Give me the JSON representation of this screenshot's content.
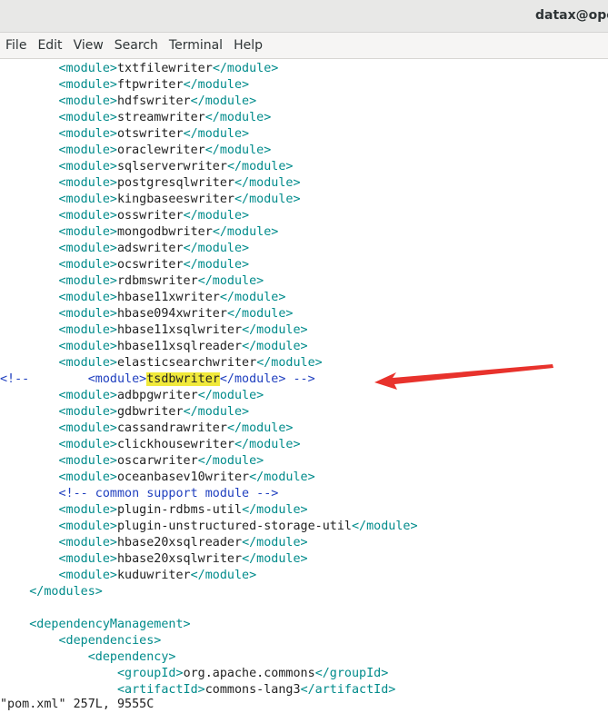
{
  "window": {
    "title": "datax@oper"
  },
  "menu": [
    "File",
    "Edit",
    "View",
    "Search",
    "Terminal",
    "Help"
  ],
  "colors": {
    "tag": "#008b8b",
    "text": "#222222",
    "comment": "#1f3fbf",
    "highlight": "#f0e93a",
    "arrow": "#e8322c"
  },
  "editor": {
    "lines": [
      {
        "indent": "        ",
        "open": "<module>",
        "text": "txtfilewriter",
        "close": "</module>"
      },
      {
        "indent": "        ",
        "open": "<module>",
        "text": "ftpwriter",
        "close": "</module>"
      },
      {
        "indent": "        ",
        "open": "<module>",
        "text": "hdfswriter",
        "close": "</module>"
      },
      {
        "indent": "        ",
        "open": "<module>",
        "text": "streamwriter",
        "close": "</module>"
      },
      {
        "indent": "        ",
        "open": "<module>",
        "text": "otswriter",
        "close": "</module>"
      },
      {
        "indent": "        ",
        "open": "<module>",
        "text": "oraclewriter",
        "close": "</module>"
      },
      {
        "indent": "        ",
        "open": "<module>",
        "text": "sqlserverwriter",
        "close": "</module>"
      },
      {
        "indent": "        ",
        "open": "<module>",
        "text": "postgresqlwriter",
        "close": "</module>"
      },
      {
        "indent": "        ",
        "open": "<module>",
        "text": "kingbaseeswriter",
        "close": "</module>"
      },
      {
        "indent": "        ",
        "open": "<module>",
        "text": "osswriter",
        "close": "</module>"
      },
      {
        "indent": "        ",
        "open": "<module>",
        "text": "mongodbwriter",
        "close": "</module>"
      },
      {
        "indent": "        ",
        "open": "<module>",
        "text": "adswriter",
        "close": "</module>"
      },
      {
        "indent": "        ",
        "open": "<module>",
        "text": "ocswriter",
        "close": "</module>"
      },
      {
        "indent": "        ",
        "open": "<module>",
        "text": "rdbmswriter",
        "close": "</module>"
      },
      {
        "indent": "        ",
        "open": "<module>",
        "text": "hbase11xwriter",
        "close": "</module>"
      },
      {
        "indent": "        ",
        "open": "<module>",
        "text": "hbase094xwriter",
        "close": "</module>"
      },
      {
        "indent": "        ",
        "open": "<module>",
        "text": "hbase11xsqlwriter",
        "close": "</module>"
      },
      {
        "indent": "        ",
        "open": "<module>",
        "text": "hbase11xsqlreader",
        "close": "</module>"
      },
      {
        "indent": "        ",
        "open": "<module>",
        "text": "elasticsearchwriter",
        "close": "</module>"
      },
      {
        "comment_open": "<!--",
        "indent": "        ",
        "open": "<module>",
        "text": "tsdbwriter",
        "close": "</module>",
        "comment_close": " -->",
        "highlight": true
      },
      {
        "indent": "        ",
        "open": "<module>",
        "text": "adbpgwriter",
        "close": "</module>"
      },
      {
        "indent": "        ",
        "open": "<module>",
        "text": "gdbwriter",
        "close": "</module>"
      },
      {
        "indent": "        ",
        "open": "<module>",
        "text": "cassandrawriter",
        "close": "</module>"
      },
      {
        "indent": "        ",
        "open": "<module>",
        "text": "clickhousewriter",
        "close": "</module>"
      },
      {
        "indent": "        ",
        "open": "<module>",
        "text": "oscarwriter",
        "close": "</module>"
      },
      {
        "indent": "        ",
        "open": "<module>",
        "text": "oceanbasev10writer",
        "close": "</module>"
      },
      {
        "indent": "        ",
        "comment": "<!-- common support module -->"
      },
      {
        "indent": "        ",
        "open": "<module>",
        "text": "plugin-rdbms-util",
        "close": "</module>"
      },
      {
        "indent": "        ",
        "open": "<module>",
        "text": "plugin-unstructured-storage-util",
        "close": "</module>"
      },
      {
        "indent": "        ",
        "open": "<module>",
        "text": "hbase20xsqlreader",
        "close": "</module>"
      },
      {
        "indent": "        ",
        "open": "<module>",
        "text": "hbase20xsqlwriter",
        "close": "</module>"
      },
      {
        "indent": "        ",
        "open": "<module>",
        "text": "kuduwriter",
        "close": "</module>"
      },
      {
        "indent": "    ",
        "open": "</modules>"
      },
      {
        "indent": ""
      },
      {
        "indent": "    ",
        "open": "<dependencyManagement>"
      },
      {
        "indent": "        ",
        "open": "<dependencies>"
      },
      {
        "indent": "            ",
        "open": "<dependency>"
      },
      {
        "indent": "                ",
        "open": "<groupId>",
        "text": "org.apache.commons",
        "close": "</groupId>"
      },
      {
        "indent": "                ",
        "open": "<artifactId>",
        "text": "commons-lang3",
        "close": "</artifactId>"
      }
    ],
    "status": "\"pom.xml\" 257L, 9555C"
  }
}
